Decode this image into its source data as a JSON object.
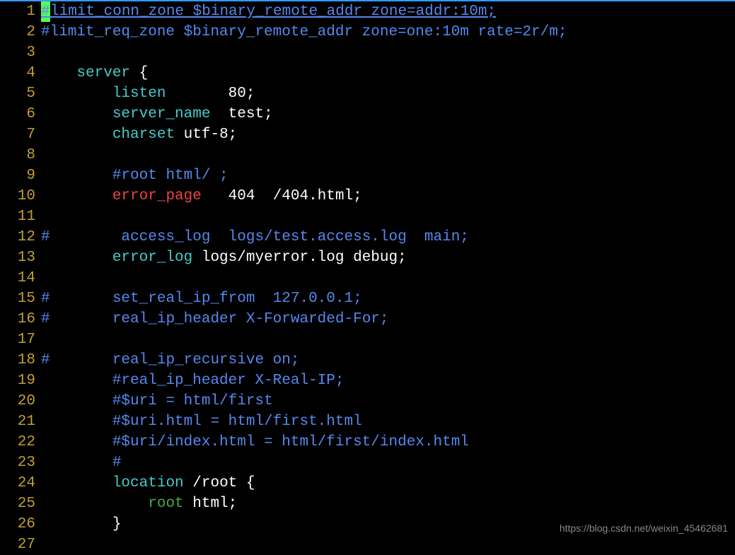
{
  "lines": [
    {
      "num": "1"
    },
    {
      "num": "2"
    },
    {
      "num": "3"
    },
    {
      "num": "4"
    },
    {
      "num": "5"
    },
    {
      "num": "6"
    },
    {
      "num": "7"
    },
    {
      "num": "8"
    },
    {
      "num": "9"
    },
    {
      "num": "10"
    },
    {
      "num": "11"
    },
    {
      "num": "12"
    },
    {
      "num": "13"
    },
    {
      "num": "14"
    },
    {
      "num": "15"
    },
    {
      "num": "16"
    },
    {
      "num": "17"
    },
    {
      "num": "18"
    },
    {
      "num": "19"
    },
    {
      "num": "20"
    },
    {
      "num": "21"
    },
    {
      "num": "22"
    },
    {
      "num": "23"
    },
    {
      "num": "24"
    },
    {
      "num": "25"
    },
    {
      "num": "26"
    },
    {
      "num": "27"
    }
  ],
  "l1": {
    "hash": "#",
    "rest": "limit_conn_zone $binary_remote_addr zone=addr:10m;"
  },
  "l2": {
    "text": "#limit_req_zone $binary_remote_addr zone=one:10m rate=2r/m;"
  },
  "l4": {
    "indent": "    ",
    "kw": "server",
    "rest": " {"
  },
  "l5": {
    "indent": "        ",
    "kw": "listen",
    "spaces": "       ",
    "val": "80",
    "semi": ";"
  },
  "l6": {
    "indent": "        ",
    "kw": "server_name",
    "spaces": "  ",
    "val": "test;"
  },
  "l7": {
    "indent": "        ",
    "kw": "charset",
    "spaces": " ",
    "val": "utf-8;"
  },
  "l9": {
    "indent": "        ",
    "text": "#root html/ ;"
  },
  "l10": {
    "indent": "        ",
    "kw": "error_page",
    "spaces": "   ",
    "code": "404",
    "rest": "  /404.html;"
  },
  "l12": {
    "prefix": "#        ",
    "kw": "access_log",
    "rest": "  logs/test.access.log  main;"
  },
  "l13": {
    "indent": "        ",
    "kw": "error_log",
    "rest": " logs/myerror.log debug;"
  },
  "l15": {
    "prefix": "#       ",
    "kw": "set_real_ip_from",
    "rest": "  127.0.0.1;"
  },
  "l16": {
    "prefix": "#       ",
    "kw": "real_ip_header",
    "rest": " X-Forwarded-For;"
  },
  "l18": {
    "prefix": "#       ",
    "kw": "real_ip_recursive",
    "rest": " on;"
  },
  "l19": {
    "indent": "        ",
    "hash": "#",
    "kw": "real_ip_header",
    "rest": " X-Real-IP;"
  },
  "l20": {
    "indent": "        ",
    "text": "#$uri = html/first"
  },
  "l21": {
    "indent": "        ",
    "text": "#$uri.html = html/first.html"
  },
  "l22": {
    "indent": "        ",
    "text": "#$uri/index.html = html/first/index.html"
  },
  "l23": {
    "indent": "        ",
    "text": "#"
  },
  "l24": {
    "indent": "        ",
    "kw": "location",
    "rest": " /root {"
  },
  "l25": {
    "indent": "            ",
    "kw": "root",
    "rest": " html;"
  },
  "l26": {
    "indent": "        ",
    "text": "}"
  },
  "watermark": "https://blog.csdn.net/weixin_45462681"
}
